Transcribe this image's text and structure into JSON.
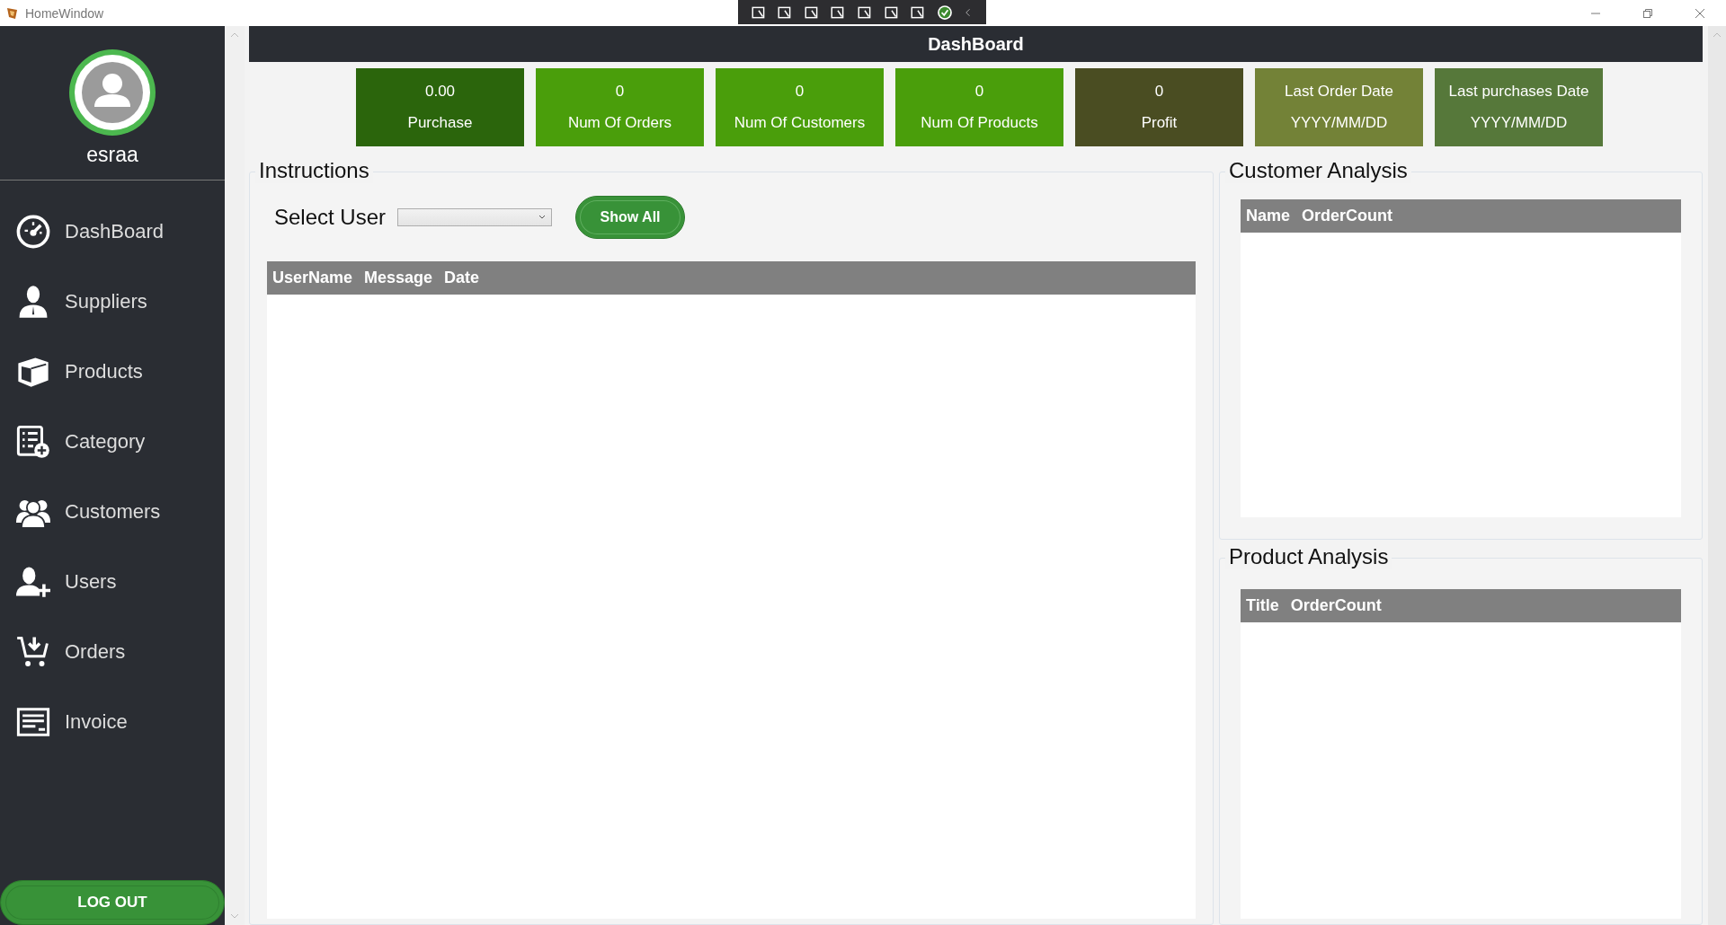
{
  "window": {
    "title": "HomeWindow"
  },
  "sidebar": {
    "user_name": "esraa",
    "items": [
      {
        "label": "DashBoard",
        "selected": false
      },
      {
        "label": "Suppliers",
        "selected": false
      },
      {
        "label": "Products",
        "selected": false
      },
      {
        "label": "Category",
        "selected": false
      },
      {
        "label": "Customers",
        "selected": false
      },
      {
        "label": "Users",
        "selected": false
      },
      {
        "label": "Orders",
        "selected": false
      },
      {
        "label": "Invoice",
        "selected": false
      }
    ],
    "logout_button": "LOG OUT"
  },
  "header": {
    "title": "DashBoard"
  },
  "stats": [
    {
      "value": "0.00",
      "label": "Purchase",
      "color": "#2b650c"
    },
    {
      "value": "0",
      "label": "Num Of Orders",
      "color": "#4a9e0b"
    },
    {
      "value": "0",
      "label": "Num Of Customers",
      "color": "#4a9e0b"
    },
    {
      "value": "0",
      "label": "Num Of Products",
      "color": "#4a9e0b"
    },
    {
      "value": "0",
      "label": "Profit",
      "color": "#4a4d22"
    },
    {
      "value": "Last Order Date",
      "label": "YYYY/MM/DD",
      "color": "#738237"
    },
    {
      "value": "Last purchases Date",
      "label": "YYYY/MM/DD",
      "color": "#56783a"
    }
  ],
  "instructions": {
    "title": "Instructions",
    "select_label": "Select User",
    "show_all_button": "Show All",
    "table": {
      "columns": [
        "UserName",
        "Message",
        "Date"
      ]
    }
  },
  "customer_analysis": {
    "title": "Customer Analysis",
    "table": {
      "columns": [
        "Name",
        "OrderCount"
      ]
    }
  },
  "product_analysis": {
    "title": "Product Analysis",
    "table": {
      "columns": [
        "Title",
        "OrderCount"
      ]
    }
  }
}
